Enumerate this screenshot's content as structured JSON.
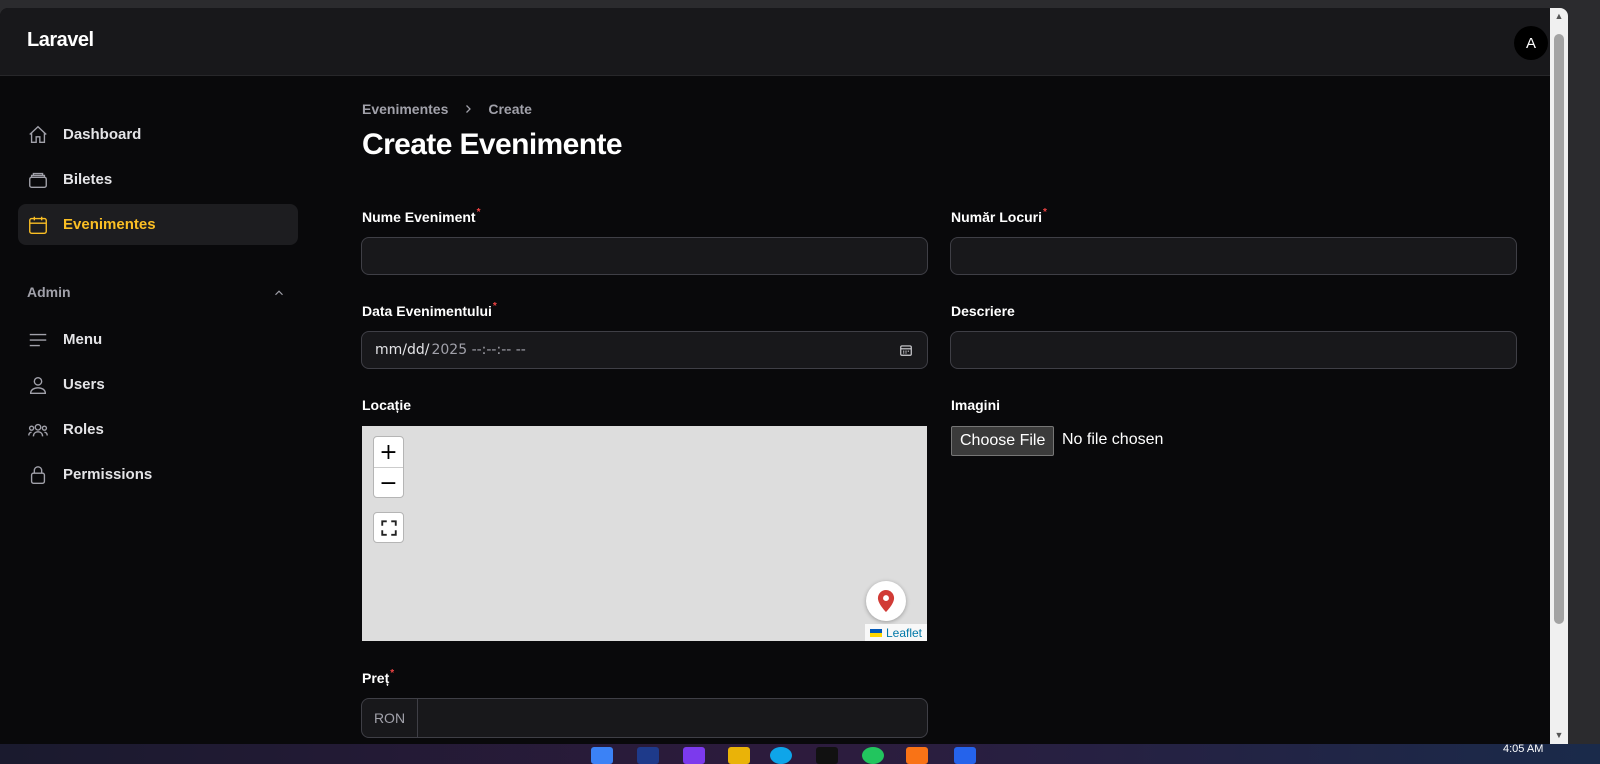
{
  "app": {
    "brand": "Laravel",
    "avatar_initial": "A"
  },
  "sidebar": {
    "items": [
      {
        "label": "Dashboard",
        "icon": "home-icon",
        "active": false
      },
      {
        "label": "Biletes",
        "icon": "inbox-stack-icon",
        "active": false
      },
      {
        "label": "Evenimentes",
        "icon": "calendar-icon",
        "active": true
      }
    ],
    "admin_group": {
      "label": "Admin",
      "collapse_icon": "chevron-up-icon",
      "items": [
        {
          "label": "Menu",
          "icon": "bars-icon"
        },
        {
          "label": "Users",
          "icon": "user-icon"
        },
        {
          "label": "Roles",
          "icon": "user-group-icon"
        },
        {
          "label": "Permissions",
          "icon": "lock-icon"
        }
      ]
    }
  },
  "breadcrumb": {
    "parent": "Evenimentes",
    "current": "Create"
  },
  "page": {
    "title": "Create Evenimente"
  },
  "form": {
    "nume_eveniment": {
      "label": "Nume Eveniment",
      "required": true,
      "value": ""
    },
    "numar_locuri": {
      "label": "Număr Locuri",
      "required": true,
      "value": ""
    },
    "data_evenimentului": {
      "label": "Data Evenimentului",
      "required": true,
      "value_part1": "mm/dd/",
      "value_part2": "2025 --:--:-- --"
    },
    "descriere": {
      "label": "Descriere",
      "required": false,
      "value": ""
    },
    "locatie": {
      "label": "Locație",
      "attribution": "Leaflet",
      "zoom_in": "+",
      "zoom_out": "−"
    },
    "imagini": {
      "label": "Imagini",
      "button": "Choose File",
      "status": "No file chosen"
    },
    "pret": {
      "label": "Preț",
      "required": true,
      "prefix": "RON",
      "value": ""
    }
  },
  "colors": {
    "accent": "#fbbf24",
    "background": "#09090b",
    "topbar": "#18181b",
    "required": "#ef4444"
  },
  "taskbar": {
    "time": "4:05 AM"
  }
}
